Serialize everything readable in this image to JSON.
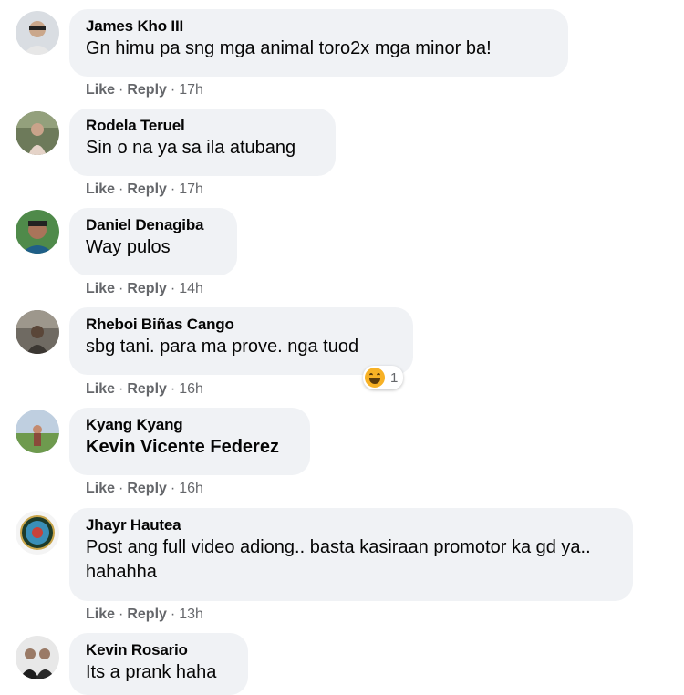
{
  "actions": {
    "like": "Like",
    "reply": "Reply",
    "sep": "·"
  },
  "comments": [
    {
      "author": "James Kho III",
      "text": "Gn himu pa sng mga animal toro2x mga minor ba!",
      "time": "17h"
    },
    {
      "author": "Rodela Teruel",
      "text": "Sin o na ya sa ila atubang",
      "time": "17h"
    },
    {
      "author": "Daniel Denagiba",
      "text": "Way pulos",
      "time": "14h"
    },
    {
      "author": "Rheboi Biñas Cango",
      "text": "sbg tani. para ma prove. nga tuod",
      "time": "16h",
      "reaction": {
        "icon": "haha-emoji-icon",
        "count": "1"
      }
    },
    {
      "author": "Kyang Kyang",
      "text": "Kevin Vicente Federez",
      "time": "16h"
    },
    {
      "author": "Jhayr Hautea",
      "text": "Post ang full video adiong.. basta kasiraan promotor ka gd ya.. hahahha",
      "time": "13h"
    },
    {
      "author": "Kevin Rosario",
      "text": "Its a prank haha"
    }
  ]
}
